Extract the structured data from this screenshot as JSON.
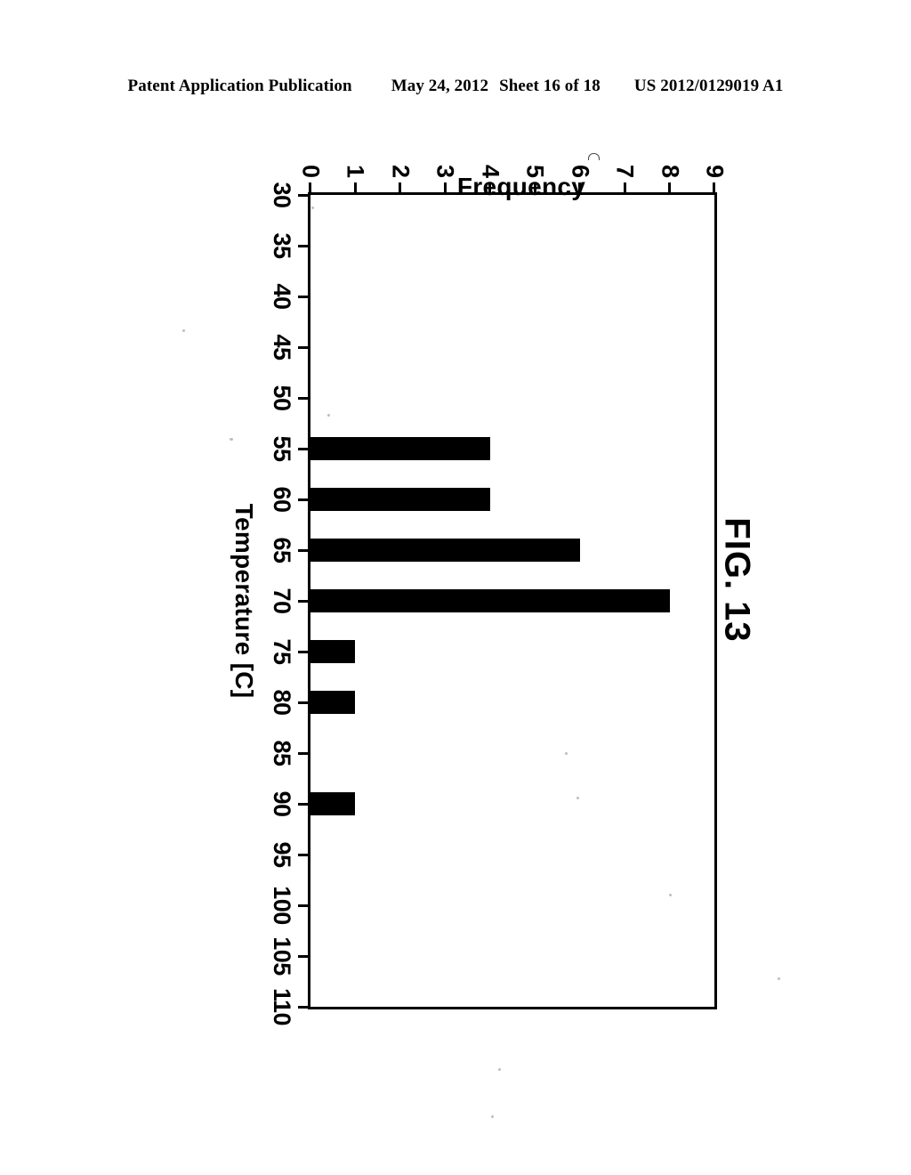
{
  "header": {
    "publication": "Patent Application Publication",
    "date": "May 24, 2012",
    "sheet": "Sheet 16 of 18",
    "patent_number": "US 2012/0129019 A1"
  },
  "figure": {
    "caption": "FIG. 13"
  },
  "chart_data": {
    "type": "bar",
    "title": "",
    "orientation": "vertical-histogram-rotated-90",
    "xlabel": "Temperature [C]",
    "ylabel": "Frequency",
    "categories": [
      30,
      35,
      40,
      45,
      50,
      55,
      60,
      65,
      70,
      75,
      80,
      85,
      90,
      95,
      100,
      105,
      110
    ],
    "xticklabels": [
      "30",
      "35",
      "40",
      "45",
      "50",
      "55",
      "60",
      "65",
      "70",
      "75",
      "80",
      "85",
      "90",
      "95",
      "100",
      "105",
      "110"
    ],
    "values": [
      0,
      0,
      0,
      0,
      0,
      4,
      4,
      6,
      8,
      1,
      1,
      0,
      1,
      0,
      0,
      0,
      0
    ],
    "yticklabels": [
      "0",
      "1",
      "2",
      "3",
      "4",
      "5",
      "6",
      "7",
      "8",
      "9"
    ],
    "xlim": [
      30,
      110
    ],
    "ylim": [
      0,
      9
    ],
    "xtick_step": 5,
    "ytick_step": 1,
    "grid": false,
    "legend": null,
    "bar_color": "#000000",
    "frame_color": "#000000",
    "background": "#ffffff"
  }
}
